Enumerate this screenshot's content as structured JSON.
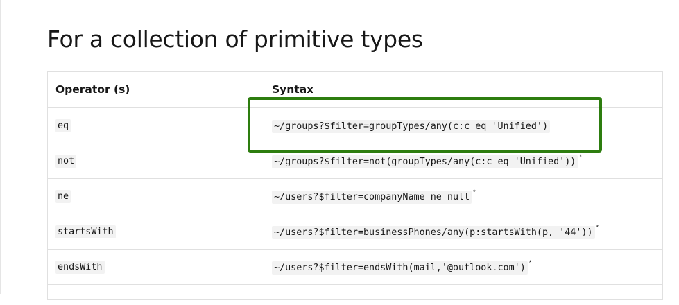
{
  "section": {
    "title": "For a collection of primitive types"
  },
  "table": {
    "headers": [
      "Operator (s)",
      "Syntax"
    ],
    "rows": [
      {
        "operator": "eq",
        "syntax": "~/groups?$filter=groupTypes/any(c:c eq 'Unified')",
        "note": ""
      },
      {
        "operator": "not",
        "syntax": "~/groups?$filter=not(groupTypes/any(c:c eq 'Unified'))",
        "note": "*"
      },
      {
        "operator": "ne",
        "syntax": "~/users?$filter=companyName ne null",
        "note": "*"
      },
      {
        "operator": "startsWith",
        "syntax": "~/users?$filter=businessPhones/any(p:startsWith(p, '44'))",
        "note": "*"
      },
      {
        "operator": "endsWith",
        "syntax": "~/users?$filter=endsWith(mail,'@outlook.com')",
        "note": "*"
      }
    ]
  },
  "annotation": {
    "highlight_color": "#2d7d0f",
    "highlighted_row": 0
  }
}
